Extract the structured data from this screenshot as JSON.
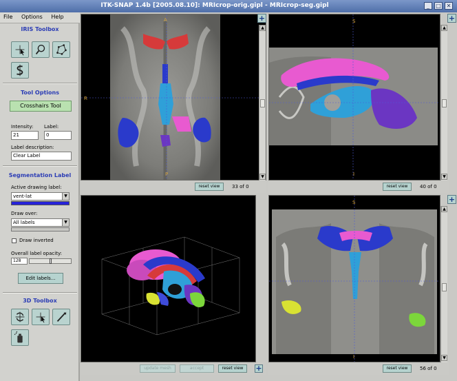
{
  "window": {
    "title": "ITK-SNAP 1.4b [2005.08.10]: MRIcrop-orig.gipl - MRIcrop-seg.gipl",
    "controls": [
      "_",
      "□",
      "✕"
    ]
  },
  "menu": [
    "File",
    "Options",
    "Help"
  ],
  "sidebar": {
    "iris_toolbox_title": "IRIS Toolbox",
    "tool_options_title": "Tool Options",
    "current_tool": "Crosshairs Tool",
    "intensity_label": "Intensity:",
    "intensity_value": "21",
    "label_label": "Label:",
    "label_value": "0",
    "label_description_label": "Label description:",
    "label_description_value": "Clear Label",
    "segmentation_title": "Segmentation Label",
    "active_drawing_label": "Active drawing label:",
    "active_drawing_value": "vent-lat",
    "active_color": "#2622d9",
    "draw_over_label": "Draw over:",
    "draw_over_value": "All labels",
    "draw_inverted_label": "Draw inverted",
    "opacity_label": "Overall label opacity:",
    "opacity_value": "128",
    "opacity_fraction": 0.5,
    "edit_labels_button": "Edit labels...",
    "toolbox_3d_title": "3D Toolbox"
  },
  "views": {
    "axial": {
      "slice": "33 of 0",
      "reset": "reset view",
      "top": "A",
      "bottom": "P",
      "left": "R",
      "right": "L"
    },
    "sagittal": {
      "slice": "40 of 0",
      "reset": "reset view",
      "top": "S",
      "bottom": "I"
    },
    "threed": {
      "update_mesh": "update mesh",
      "accept": "accept",
      "reset": "reset view"
    },
    "coronal": {
      "slice": "56 of 0",
      "reset": "reset view",
      "top": "S",
      "bottom": "I"
    }
  },
  "labels_colors": {
    "pink": "#e85ad0",
    "blue": "#2a3acb",
    "cyan": "#2fa0d8",
    "red": "#d63a3a",
    "purple": "#6b36c2",
    "yellow": "#d9e233",
    "green": "#7cd63b"
  }
}
